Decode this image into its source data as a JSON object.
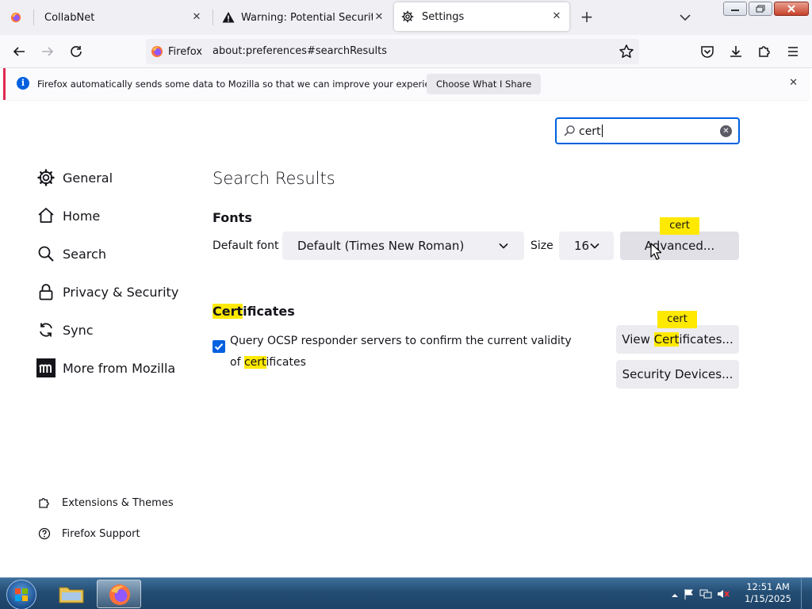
{
  "browser": {
    "tabs": [
      {
        "title": "CollabNet",
        "icon": "firefox-icon"
      },
      {
        "title": "Warning: Potential Security Risk Ahead",
        "icon": "warning-icon"
      },
      {
        "title": "Settings",
        "icon": "gear-icon",
        "selected": true
      }
    ],
    "identity_label": "Firefox",
    "url": "about:preferences#searchResults",
    "close_glyph": "✕",
    "new_tab_glyph": "+"
  },
  "notification": {
    "message": "Firefox automatically sends some data to Mozilla so that we can improve your experience.",
    "button": "Choose What I Share",
    "close_glyph": "✕",
    "accent": "#e22850"
  },
  "search": {
    "value": "cert"
  },
  "sidebar": {
    "items": [
      {
        "label": "General",
        "icon": "gear-icon"
      },
      {
        "label": "Home",
        "icon": "home-icon"
      },
      {
        "label": "Search",
        "icon": "search-icon"
      },
      {
        "label": "Privacy & Security",
        "icon": "lock-icon"
      },
      {
        "label": "Sync",
        "icon": "sync-icon"
      },
      {
        "label": "More from Mozilla",
        "icon": "mozilla-icon"
      }
    ],
    "footer": [
      {
        "label": "Extensions & Themes",
        "icon": "puzzle-icon"
      },
      {
        "label": "Firefox Support",
        "icon": "help-icon"
      }
    ]
  },
  "main": {
    "heading": "Search Results",
    "fonts": {
      "heading": "Fonts",
      "default_font_label": "Default font",
      "default_font_value": "Default (Times New Roman)",
      "size_label": "Size",
      "size_value": "16",
      "advanced_button": "Advanced...",
      "tooltip": "cert"
    },
    "certificates": {
      "heading": "Certificates",
      "checkbox_label": "Query OCSP responder servers to confirm the current validity of certificates",
      "checked": true,
      "view_button": "View Certificates...",
      "devices_button": "Security Devices...",
      "tooltip": "cert"
    }
  },
  "taskbar": {
    "time": "12:51 AM",
    "date": "1/15/2025"
  },
  "colors": {
    "accent": "#0061e0",
    "highlight": "#ffe900"
  }
}
